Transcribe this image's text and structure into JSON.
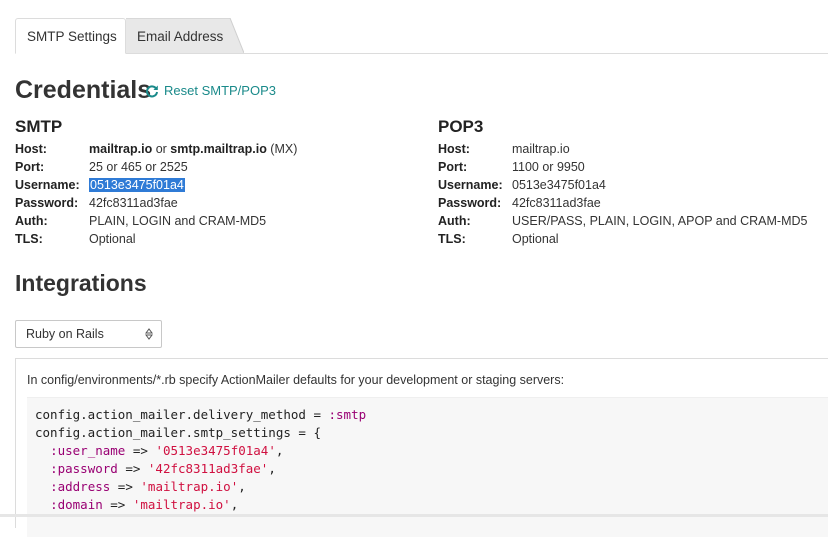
{
  "tabs": [
    {
      "label": "SMTP Settings",
      "active": true
    },
    {
      "label": "Email Address",
      "active": false
    }
  ],
  "credentials": {
    "title": "Credentials",
    "reset_label": "Reset SMTP/POP3",
    "reset_icon": "refresh-icon",
    "accent": "#1a8a8a"
  },
  "smtp": {
    "heading": "SMTP",
    "host_key": "Host:",
    "host_a": "mailtrap.io",
    "host_or": " or ",
    "host_b": "smtp.mailtrap.io",
    "host_suffix": " (MX)",
    "port_key": "Port:",
    "port": "25 or 465 or 2525",
    "username_key": "Username:",
    "username": "0513e3475f01a4",
    "password_key": "Password:",
    "password": "42fc8311ad3fae",
    "auth_key": "Auth:",
    "auth": "PLAIN, LOGIN and CRAM-MD5",
    "tls_key": "TLS:",
    "tls": "Optional"
  },
  "pop3": {
    "heading": "POP3",
    "host_key": "Host:",
    "host": "mailtrap.io",
    "port_key": "Port:",
    "port": "1100 or 9950",
    "username_key": "Username:",
    "username": "0513e3475f01a4",
    "password_key": "Password:",
    "password": "42fc8311ad3fae",
    "auth_key": "Auth:",
    "auth": "USER/PASS, PLAIN, LOGIN, APOP and CRAM-MD5",
    "tls_key": "TLS:",
    "tls": "Optional"
  },
  "integrations": {
    "title": "Integrations",
    "selected": "Ruby on Rails",
    "description": "In config/environments/*.rb specify ActionMailer defaults for your development or staging servers:",
    "code": {
      "l1_a": "config.action_mailer.delivery_method = ",
      "l1_b": ":smtp",
      "l2": "config.action_mailer.smtp_settings = {",
      "l3_a": ":user_name",
      "l3_b": " => ",
      "l3_c": "'0513e3475f01a4'",
      "l3_d": ",",
      "l4_a": ":password",
      "l4_b": " => ",
      "l4_c": "'42fc8311ad3fae'",
      "l4_d": ",",
      "l5_a": ":address",
      "l5_b": " => ",
      "l5_c": "'mailtrap.io'",
      "l5_d": ",",
      "l6_a": ":domain",
      "l6_b": " => ",
      "l6_c": "'mailtrap.io'",
      "l6_d": ","
    }
  }
}
